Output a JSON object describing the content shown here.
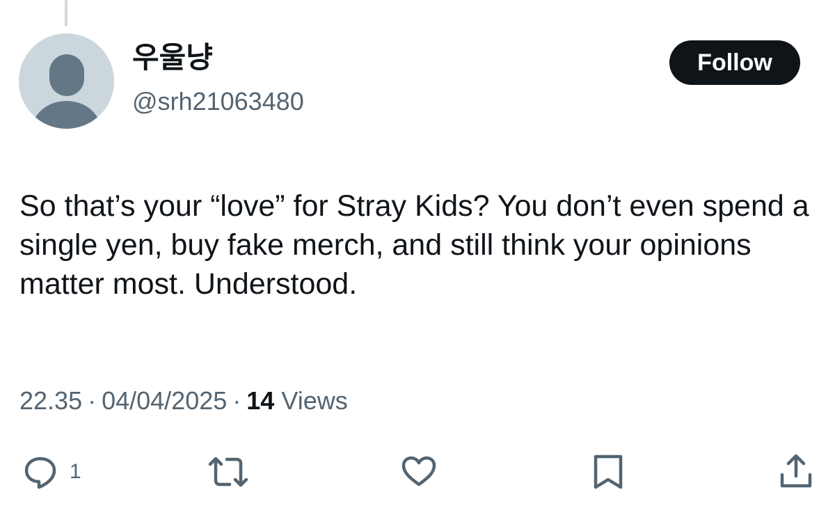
{
  "tweet": {
    "author": {
      "display_name": "우울냥",
      "handle": "@srh21063480"
    },
    "follow_label": "Follow",
    "text": "So that’s your “love” for Stray Kids? You don’t even spend a single yen, buy fake merch, and still think your opinions matter most. Understood.",
    "time": "22.35",
    "date": "04/04/2025",
    "separator": "·",
    "views_count": "14",
    "views_label": "Views",
    "reply_count": "1"
  },
  "icons": {
    "reply": "reply-icon",
    "repost": "repost-icon",
    "like": "heart-icon",
    "bookmark": "bookmark-icon",
    "share": "share-icon"
  },
  "colors": {
    "text_primary": "#0f1419",
    "text_secondary": "#536471",
    "avatar_bg": "#ccd6dd",
    "avatar_fg": "#647786",
    "follow_bg": "#0f1419",
    "follow_text": "#ffffff"
  }
}
